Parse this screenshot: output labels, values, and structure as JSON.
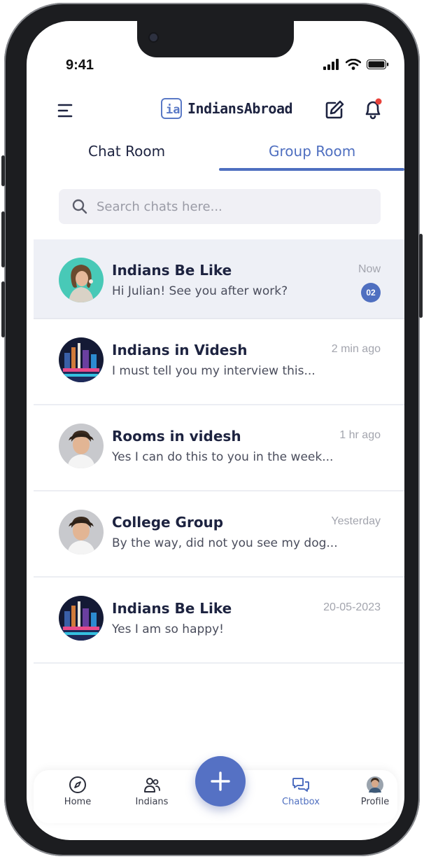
{
  "status_bar": {
    "time": "9:41"
  },
  "header": {
    "brand": "IndiansAbroad"
  },
  "tabs": [
    {
      "label": "Chat Room",
      "active": false
    },
    {
      "label": "Group Room",
      "active": true
    }
  ],
  "search": {
    "placeholder": "Search chats here..."
  },
  "chats": [
    {
      "name": "Indians Be Like",
      "message": "Hi Julian! See you after work?",
      "time": "Now",
      "unread": "02",
      "avatar": "woman-portrait"
    },
    {
      "name": "Indians in Videsh",
      "message": "I must tell you my interview this...",
      "time": "2 min ago",
      "avatar": "toronto-skyline"
    },
    {
      "name": "Rooms in videsh",
      "message": "Yes I can do this to you in the week...",
      "time": "1 hr ago",
      "avatar": "man-portrait"
    },
    {
      "name": "College Group",
      "message": "By the way, did not you see my dog...",
      "time": "Yesterday",
      "avatar": "man-portrait"
    },
    {
      "name": "Indians Be Like",
      "message": "Yes I am so happy!",
      "time": "20-05-2023",
      "avatar": "toronto-skyline"
    }
  ],
  "bottom_nav": [
    {
      "label": "Home",
      "icon": "compass-icon",
      "active": false
    },
    {
      "label": "Indians",
      "icon": "users-icon",
      "active": false
    },
    {
      "label": "Chatbox",
      "icon": "chat-icon",
      "active": true
    },
    {
      "label": "Profile",
      "icon": "avatar",
      "active": false
    }
  ],
  "colors": {
    "accent": "#4f6fc0",
    "text": "#1d2340",
    "muted": "#a3a5ae",
    "notification_dot": "#e8423b"
  }
}
